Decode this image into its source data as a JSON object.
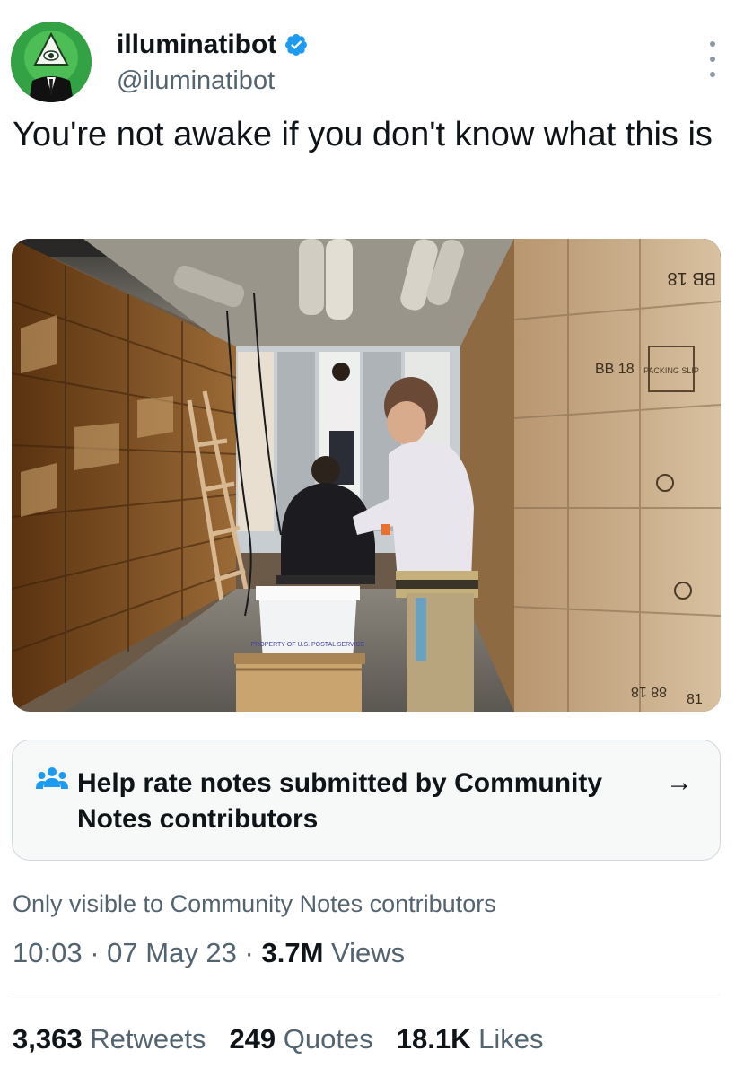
{
  "author": {
    "display_name": "illuminatibot",
    "handle": "@iluminatibot",
    "verified_icon": "verified-badge-icon",
    "avatar_icon": "eye-of-providence-avatar",
    "avatar_color": "#2e9a3a"
  },
  "tweet": {
    "text": "You're not awake if you don't know what this is"
  },
  "media": {
    "box_labels": [
      "BB 18",
      "BB 18",
      "PACKING SLIP",
      "PROPERTY OF U.S. POSTAL SERVICE",
      "88 18",
      "81"
    ]
  },
  "community_notes": {
    "icon": "people-icon",
    "prompt": "Help rate notes submitted by Community Notes contributors",
    "arrow_icon": "arrow-right-icon",
    "visibility": "Only visible to Community Notes contributors"
  },
  "meta": {
    "time": "10:03",
    "separator": "·",
    "date": "07 May 23",
    "views_count": "3.7M",
    "views_label": "Views"
  },
  "stats": {
    "retweets_count": "3,363",
    "retweets_label": "Retweets",
    "quotes_count": "249",
    "quotes_label": "Quotes",
    "likes_count": "18.1K",
    "likes_label": "Likes"
  },
  "colors": {
    "text_primary": "#0f1419",
    "text_secondary": "#536471",
    "verified_blue": "#1d9bf0",
    "card_bg": "#f7f9f9",
    "border": "#cfd9de"
  }
}
